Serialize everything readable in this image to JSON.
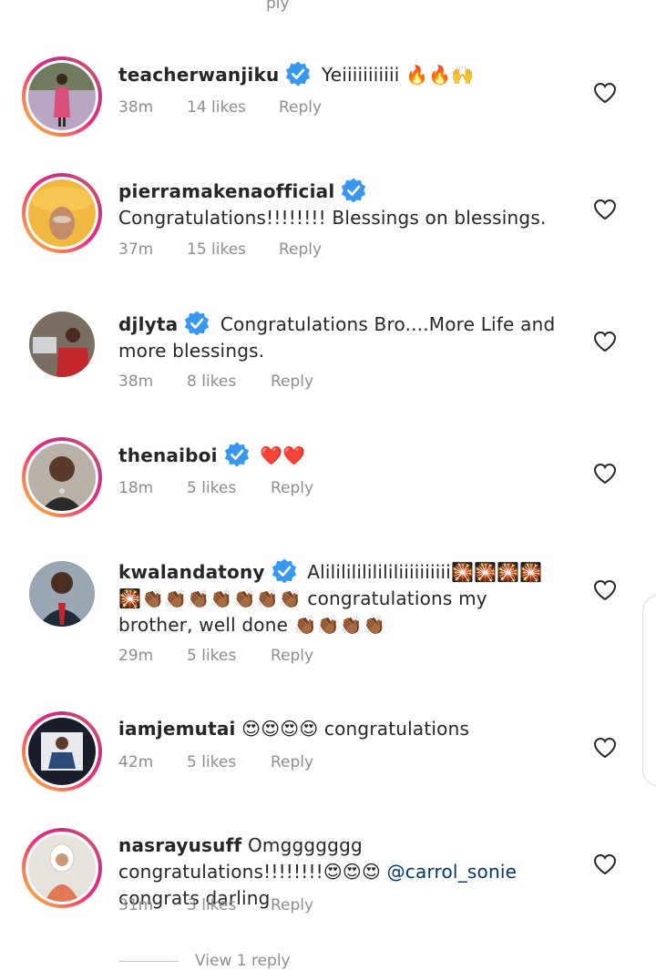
{
  "top_hint": "ply",
  "reply_label": "Reply",
  "view_replies": "View 1 reply",
  "icons": {
    "verified": "verified-badge-icon",
    "like": "heart-outline-icon"
  },
  "colors": {
    "verified": "#3897f0",
    "text": "#262626",
    "meta": "#8e8e8e",
    "mention": "#00376b"
  },
  "comments": [
    {
      "username": "teacherwanjiku",
      "verified": true,
      "text": "Yeiiiiiiiiiii 🔥🔥🙌",
      "time": "38m",
      "likes": "14 likes"
    },
    {
      "username": "pierramakenaofficial",
      "verified": true,
      "text": "Congratulations!!!!!!!! Blessings on blessings.",
      "time": "37m",
      "likes": "15 likes"
    },
    {
      "username": "djlyta",
      "verified": true,
      "text": "Congratulations Bro....More Life and more blessings.",
      "time": "38m",
      "likes": "8 likes"
    },
    {
      "username": "thenaiboi",
      "verified": true,
      "text": "❤️❤️",
      "time": "18m",
      "likes": "5 likes"
    },
    {
      "username": "kwalandatony",
      "verified": true,
      "text": "Alilililililililiiiiiiiiii🎇🎇🎇🎇🎇👏🏾👏🏾👏🏾👏🏾👏🏾👏🏾👏🏾 congratulations my brother, well done 👏🏾👏🏾👏🏾👏🏾",
      "time": "29m",
      "likes": "5 likes"
    },
    {
      "username": "iamjemutai",
      "verified": false,
      "text": "😍😍😍😍 congratulations",
      "time": "42m",
      "likes": "5 likes"
    },
    {
      "username": "nasrayusuff",
      "verified": false,
      "text_before": "Omggggggg congratulations!!!!!!!!😍😍😍 ",
      "mention": "@carrol_sonie",
      "text_after": " congrats darling",
      "time": "31m",
      "likes": "3 likes"
    }
  ]
}
